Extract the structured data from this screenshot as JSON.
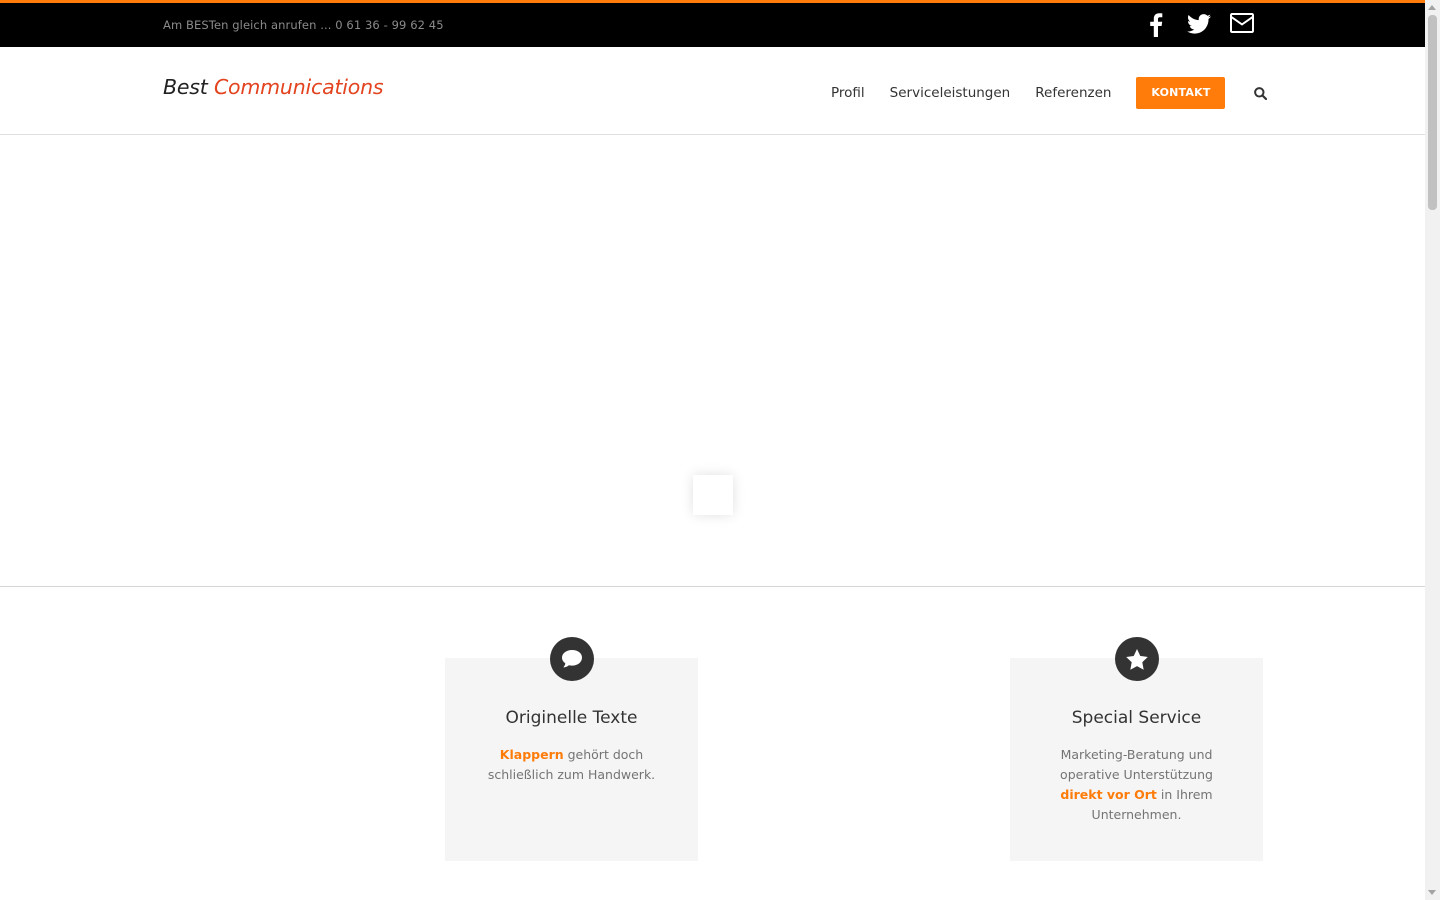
{
  "topbar": {
    "phone_text": "Am BESTen gleich anrufen ... 0 61 36 - 99 62 45",
    "social_icons": [
      "facebook-icon",
      "twitter-icon",
      "email-icon"
    ],
    "accent_color": "#ff7c0a"
  },
  "header": {
    "logo_part1": "Best",
    "logo_part2": "Communications",
    "nav": {
      "profil": "Profil",
      "service": "Serviceleistungen",
      "referenzen": "Referenzen",
      "kontakt": "KONTAKT"
    }
  },
  "features": {
    "box1": {
      "icon": "speech-bubble-icon",
      "title": "Originelle Texte",
      "highlight": "Klappern",
      "text_after": " gehört doch schließlich zum Handwerk."
    },
    "box2": {
      "icon": "star-icon",
      "title": "Special Service",
      "text_before": "Marketing-Beratung und operative Unterstützung ",
      "highlight": "direkt vor Ort",
      "text_after": " in Ihrem Unternehmen."
    }
  }
}
